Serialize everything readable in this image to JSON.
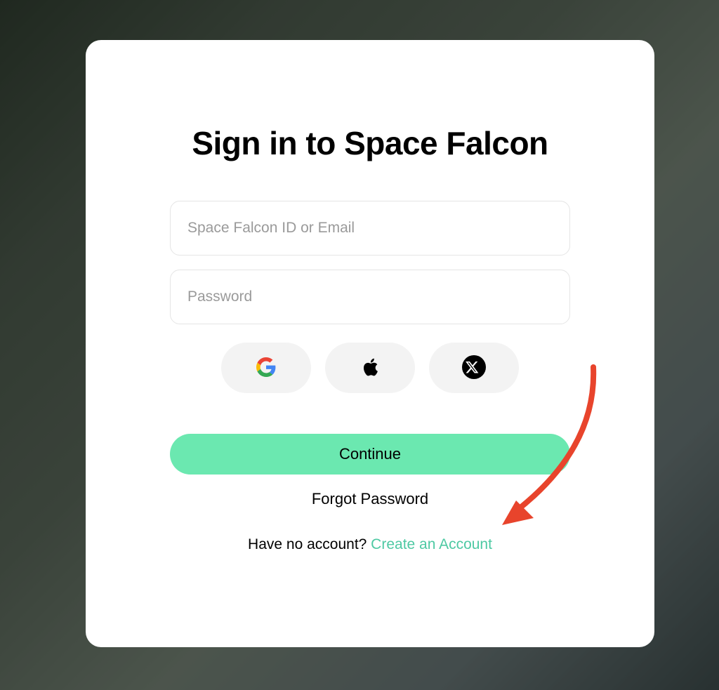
{
  "modal": {
    "title": "Sign in to Space Falcon",
    "id_placeholder": "Space Falcon ID or Email",
    "password_placeholder": "Password",
    "continue_label": "Continue",
    "forgot_label": "Forgot Password",
    "no_account_text": "Have no account? ",
    "create_account_label": "Create an Account"
  },
  "social": {
    "google": "google",
    "apple": "apple",
    "x": "x"
  }
}
